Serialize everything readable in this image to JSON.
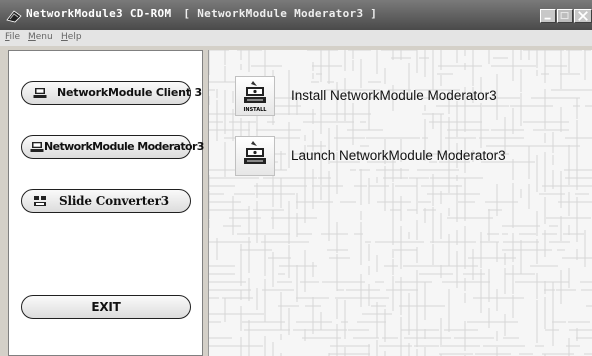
{
  "window": {
    "title": "NetworkModule3 CD-ROM",
    "subtitle": "[ NetworkModule Moderator3 ]"
  },
  "menu": [
    {
      "label": "File",
      "underline": "F",
      "rest": "ile"
    },
    {
      "label": "Menu",
      "underline": "M",
      "rest": "enu"
    },
    {
      "label": "Help",
      "underline": "H",
      "rest": "elp"
    }
  ],
  "sidebar": {
    "buttons": [
      {
        "label": "NetworkModule Client 3",
        "icon": "computer-icon"
      },
      {
        "label": "NetworkModule Moderator3",
        "icon": "computer-icon"
      },
      {
        "label": "Slide Converter3",
        "icon": "converter-icon"
      }
    ],
    "exit_label": "EXIT"
  },
  "main": {
    "actions": [
      {
        "label": "Install NetworkModule Moderator3",
        "icon": "install-icon",
        "badge": "INSTALL"
      },
      {
        "label": "Launch NetworkModule Moderator3",
        "icon": "launch-icon"
      }
    ]
  },
  "colors": {
    "titlebar": "#5a5a5a",
    "panel_bg": "#ffffff",
    "pattern_lines": "#d9d9d9"
  }
}
